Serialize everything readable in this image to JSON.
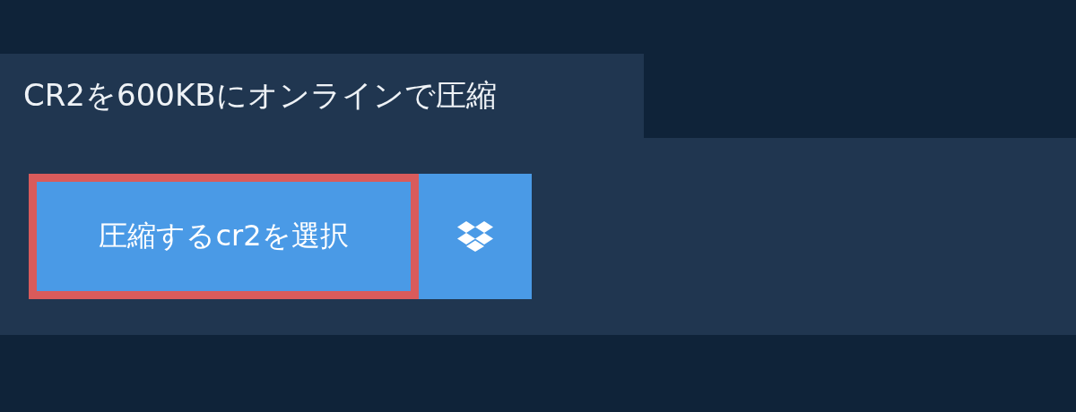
{
  "tab": {
    "title": "CR2を600KBにオンラインで圧縮"
  },
  "buttons": {
    "select": {
      "label": "圧縮するcr2を選択",
      "focused": true
    }
  }
}
